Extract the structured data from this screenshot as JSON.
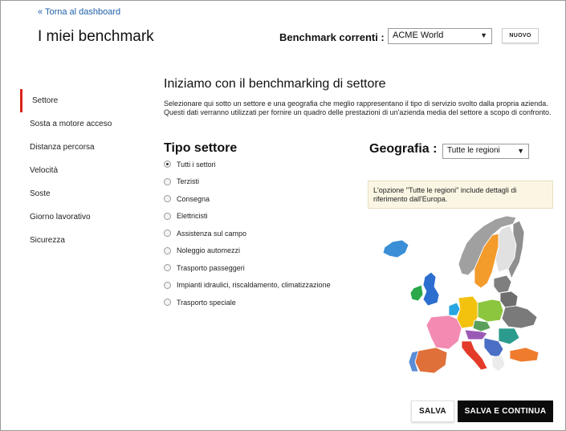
{
  "header": {
    "back_link": "« Torna al dashboard",
    "title": "I miei benchmark",
    "benchmark_label": "Benchmark correnti :",
    "benchmark_value": "ACME World",
    "new_button": "NUOVO"
  },
  "sidebar": {
    "items": [
      {
        "label": "Settore",
        "active": true
      },
      {
        "label": "Sosta a motore acceso",
        "active": false
      },
      {
        "label": "Distanza percorsa",
        "active": false
      },
      {
        "label": "Velocità",
        "active": false
      },
      {
        "label": "Soste",
        "active": false
      },
      {
        "label": "Giorno lavorativo",
        "active": false
      },
      {
        "label": "Sicurezza",
        "active": false
      }
    ]
  },
  "main": {
    "heading": "Iniziamo con il benchmarking di settore",
    "intro": "Selezionare qui sotto un settore e una geografia che meglio rappresentano il tipo di servizio svolto dalla propria azienda. Questi dati verranno utilizzati per fornire un quadro delle prestazioni di un'azienda media del settore a scopo di confronto.",
    "sector_title": "Tipo settore",
    "sectors": [
      {
        "label": "Tutti i settori",
        "checked": true
      },
      {
        "label": "Terzisti",
        "checked": false
      },
      {
        "label": "Consegna",
        "checked": false
      },
      {
        "label": "Elettricisti",
        "checked": false
      },
      {
        "label": "Assistenza sul campo",
        "checked": false
      },
      {
        "label": "Noleggio automezzi",
        "checked": false
      },
      {
        "label": "Trasporto passeggeri",
        "checked": false
      },
      {
        "label": "Impianti idraulici, riscaldamento, climatizzazione",
        "checked": false
      },
      {
        "label": "Trasporto speciale",
        "checked": false
      }
    ],
    "geo_title": "Geografia :",
    "geo_value": "Tutte le regioni",
    "geo_note": "L'opzione \"Tutte le regioni\" include dettagli di riferimento dall'Europa."
  },
  "map": {
    "colors": {
      "iceland": "#3a8fd6",
      "uk": "#2c6ecf",
      "ireland": "#2aa84a",
      "norway": "#a0a0a0",
      "sweden": "#f39b2b",
      "finland": "#e1e1e1",
      "russia": "#8f8f8f",
      "baltics": "#7f7f7f",
      "poland": "#8cc63f",
      "germany": "#f2c20f",
      "france": "#f38ab2",
      "spain": "#e0703a",
      "portugal": "#5b8ed6",
      "italy": "#e43a2a",
      "ukraine": "#7a7a7a",
      "balkans": "#4a6fc4",
      "turkey": "#ef7b2d",
      "benelux": "#27a6e1",
      "austria": "#9b59b6",
      "czech": "#5aa05a",
      "romania": "#2a9b8c",
      "greece": "#ebebeb",
      "belarus": "#6e6e6e"
    }
  },
  "actions": {
    "save": "SALVA",
    "save_continue": "SALVA E CONTINUA"
  }
}
